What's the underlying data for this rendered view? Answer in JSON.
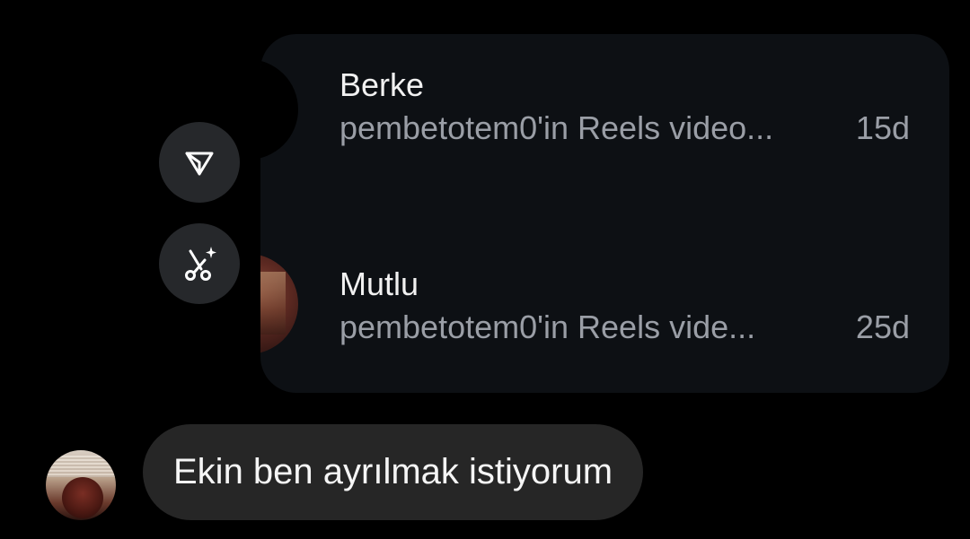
{
  "shared_post": {
    "rows": [
      {
        "name": "Berke",
        "preview": "pembetotem0'in Reels video...",
        "time": "15d"
      },
      {
        "name": "Mutlu",
        "preview": "pembetotem0'in Reels vide...",
        "time": "25d"
      }
    ]
  },
  "actions": {
    "share_icon": "paper-plane-icon",
    "remix_icon": "remix-sparkle-icon"
  },
  "message": {
    "text": "Ekin ben ayrılmak istiyorum"
  },
  "colors": {
    "background": "#000000",
    "card": "#0d1014",
    "bubble": "#262626",
    "action_button": "#26282b",
    "primary_text": "#f1f1f1",
    "secondary_text": "#9a9ea6"
  }
}
